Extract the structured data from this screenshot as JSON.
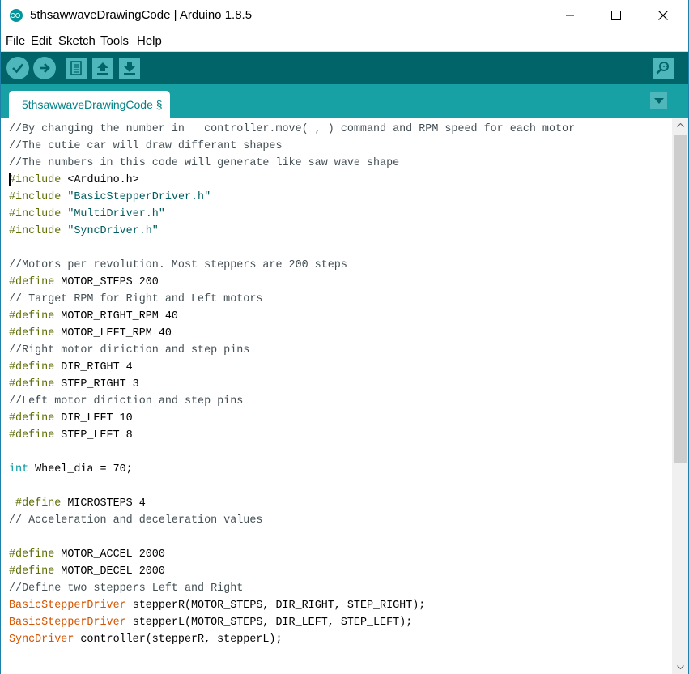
{
  "window": {
    "title": "5thsawwaveDrawingCode | Arduino 1.8.5",
    "controls": [
      "minimize",
      "maximize",
      "close"
    ]
  },
  "menu": {
    "file": "File",
    "edit": "Edit",
    "sketch": "Sketch",
    "tools": "Tools",
    "help": "Help"
  },
  "toolbar": {
    "buttons": [
      {
        "name": "verify",
        "icon": "checkmark-icon"
      },
      {
        "name": "upload",
        "icon": "arrow-right-icon"
      },
      {
        "name": "new",
        "icon": "document-icon"
      },
      {
        "name": "open",
        "icon": "arrow-up-icon"
      },
      {
        "name": "save",
        "icon": "arrow-down-icon"
      },
      {
        "name": "serial-monitor",
        "icon": "magnifier-icon"
      }
    ]
  },
  "tabs": {
    "active": "5thsawwaveDrawingCode §",
    "menu_icon": "triangle-down-icon"
  },
  "colors": {
    "toolbar_bg": "#006468",
    "tabbar_bg": "#17a1a5",
    "button_bg": "#4db7bb",
    "comment": "#434f54",
    "preprocessor": "#5e6d03",
    "string": "#005c5f",
    "type": "#00979c",
    "class": "#d35400"
  },
  "code": {
    "lines": [
      "//By changing the number in   controller.move( , ) command and RPM speed for each motor",
      "//The cutie car will draw differant shapes",
      "//The numbers in this code will generate like saw wave shape",
      "#include <Arduino.h>",
      "#include \"BasicStepperDriver.h\"",
      "#include \"MultiDriver.h\"",
      "#include \"SyncDriver.h\"",
      "",
      "//Motors per revolution. Most steppers are 200 steps",
      "#define MOTOR_STEPS 200",
      "// Target RPM for Right and Left motors",
      "#define MOTOR_RIGHT_RPM 40",
      "#define MOTOR_LEFT_RPM 40",
      "//Right motor diriction and step pins",
      "#define DIR_RIGHT 4",
      "#define STEP_RIGHT 3",
      "//Left motor diriction and step pins",
      "#define DIR_LEFT 10",
      "#define STEP_LEFT 8",
      "",
      "int Wheel_dia = 70;",
      "",
      " #define MICROSTEPS 4",
      "// Acceleration and deceleration values",
      "",
      "#define MOTOR_ACCEL 2000",
      "#define MOTOR_DECEL 2000",
      "//Define two steppers Left and Right",
      "BasicStepperDriver stepperR(MOTOR_STEPS, DIR_RIGHT, STEP_RIGHT);",
      "BasicStepperDriver stepperL(MOTOR_STEPS, DIR_LEFT, STEP_LEFT);",
      "SyncDriver controller(stepperR, stepperL);"
    ]
  }
}
